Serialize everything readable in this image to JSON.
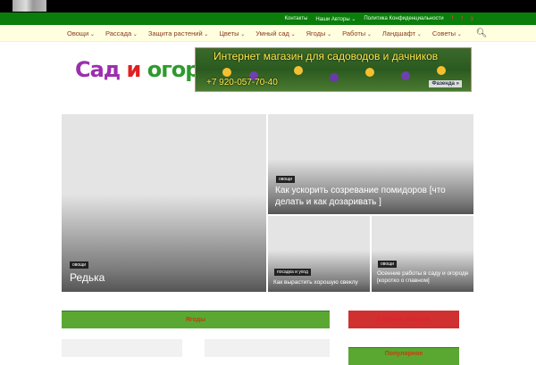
{
  "topbar": {
    "links": [
      "Контакты",
      "Наши Авторы ⌄",
      "Политика Конфиденциальности"
    ],
    "social": [
      "f",
      "t",
      "y"
    ]
  },
  "nav": {
    "items": [
      "Овощи",
      "Рассада",
      "Защита растений",
      "Цветы",
      "Умный сад",
      "Ягоды",
      "Работы",
      "Ландшафт",
      "Советы"
    ],
    "search_icon": "search-icon"
  },
  "logo": {
    "part1": "Сад ",
    "part2": "и ",
    "part3": "огород"
  },
  "banner": {
    "title": "Интернет магазин для садоводов и дачников",
    "phone": "+7 920-057-70-40",
    "brand": "Фазенда »"
  },
  "featured": [
    {
      "tag": "овощи",
      "title": "Редька"
    },
    {
      "tag": "овощи",
      "title": "Как ускорить созревание помидоров [что делать и как дозаривать ]"
    },
    {
      "tag": "посадка и уход",
      "title": "Как вырастить хорошую свеклу"
    },
    {
      "tag": "овощи",
      "title": "Осенние работы в саду и огороде [коротко о главном]"
    }
  ],
  "sections": {
    "berries": "Ягоды",
    "hot": "Горячие новости",
    "popular": "Популярное"
  },
  "colors": {
    "green": "#0a7d0a",
    "section_green": "#5aa832",
    "section_red": "#d03030"
  }
}
